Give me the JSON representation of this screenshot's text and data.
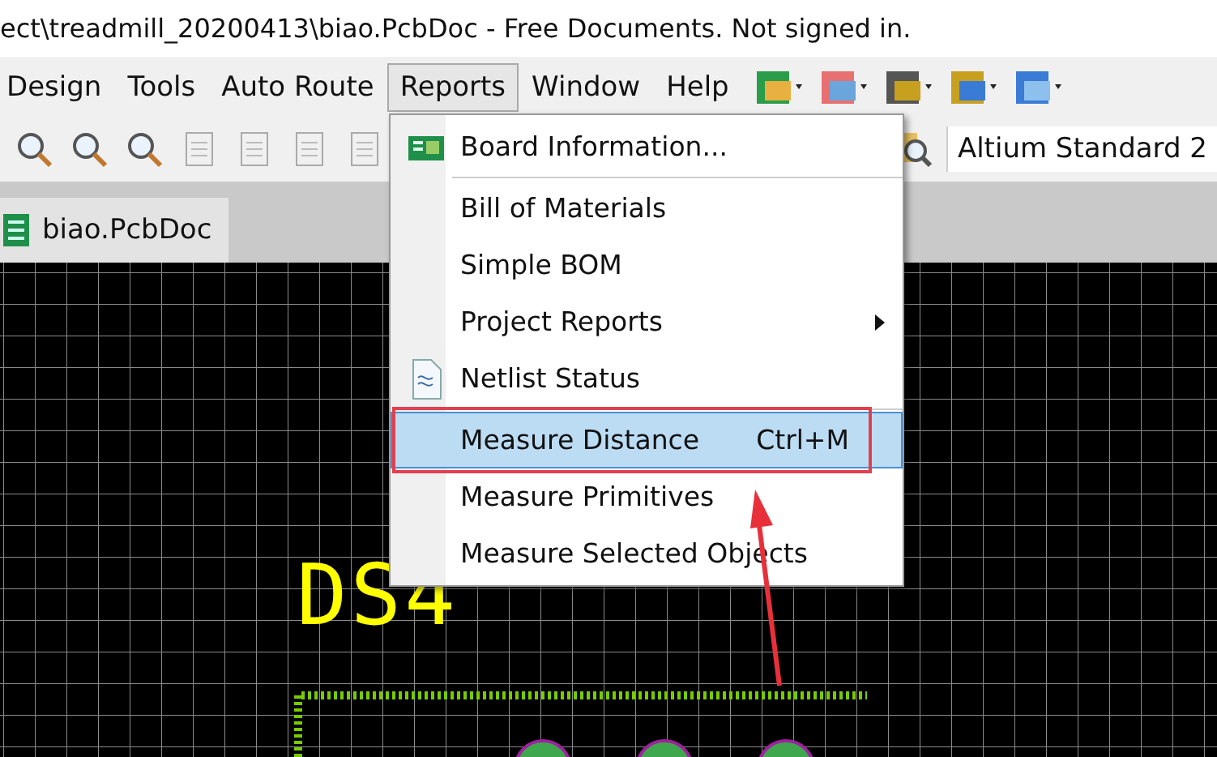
{
  "window": {
    "title": "ect\\treadmill_20200413\\biao.PcbDoc - Free Documents. Not signed in."
  },
  "menu_bar": [
    {
      "label": "Design",
      "selected": false
    },
    {
      "label": "Tools",
      "selected": false
    },
    {
      "label": "Auto Route",
      "selected": false
    },
    {
      "label": "Reports",
      "selected": true
    },
    {
      "label": "Window",
      "selected": false
    },
    {
      "label": "Help",
      "selected": false
    }
  ],
  "toolbar": {
    "combo": "Altium Standard 2"
  },
  "tabs": [
    {
      "label": "biao.PcbDoc",
      "selected": true
    }
  ],
  "menu": [
    {
      "kind": "item",
      "label": "Board Information...",
      "icon": true,
      "selected": false
    },
    {
      "kind": "separator"
    },
    {
      "kind": "item",
      "label": "Bill of Materials",
      "selected": false
    },
    {
      "kind": "item",
      "label": "Simple BOM",
      "selected": false
    },
    {
      "kind": "submenu",
      "label": "Project Reports",
      "selected": false
    },
    {
      "kind": "item",
      "label": "Netlist Status",
      "icon": true,
      "selected": false
    },
    {
      "kind": "separator"
    },
    {
      "kind": "item",
      "label": "Measure Distance",
      "shortcut": "Ctrl+M",
      "selected": true
    },
    {
      "kind": "item",
      "label": "Measure Primitives",
      "selected": false
    },
    {
      "kind": "item",
      "label": "Measure Selected Objects",
      "selected": false
    }
  ],
  "canvas": {
    "designator": "DS4"
  }
}
